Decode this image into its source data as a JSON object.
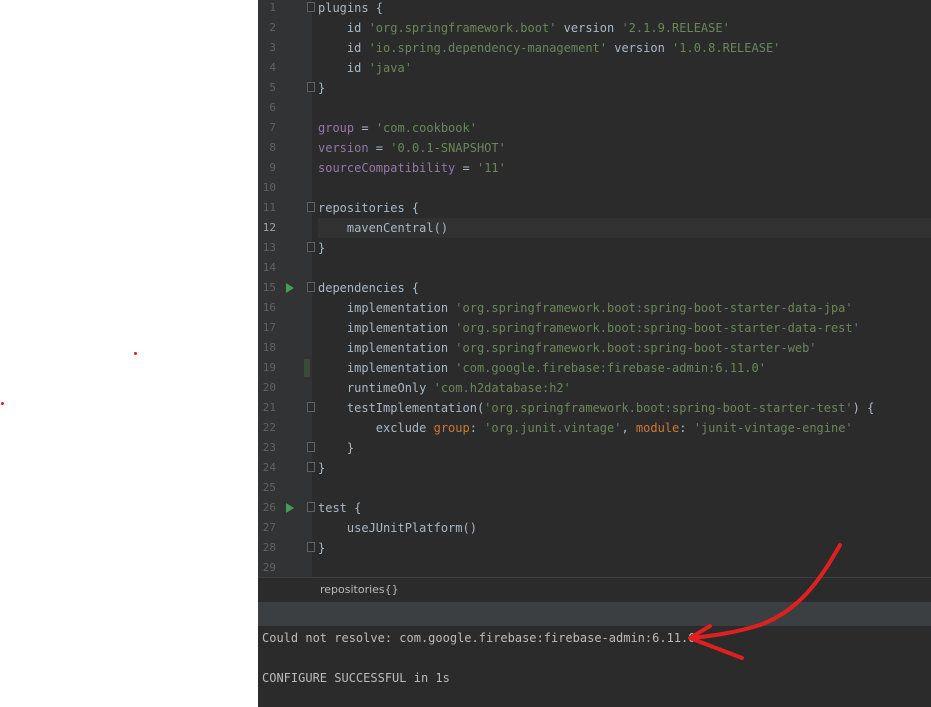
{
  "editor": {
    "current_line": 12,
    "lines": [
      {
        "num": "1",
        "fold": true,
        "run": false,
        "tokens": [
          {
            "t": "plugins {",
            "c": "plain"
          }
        ]
      },
      {
        "num": "2",
        "tokens": [
          {
            "t": "    id ",
            "c": "plain"
          },
          {
            "t": "'org.springframework.boot'",
            "c": "str"
          },
          {
            "t": " version ",
            "c": "plain"
          },
          {
            "t": "'2.1.9.RELEASE'",
            "c": "str"
          }
        ]
      },
      {
        "num": "3",
        "tokens": [
          {
            "t": "    id ",
            "c": "plain"
          },
          {
            "t": "'io.spring.dependency-management'",
            "c": "str"
          },
          {
            "t": " version ",
            "c": "plain"
          },
          {
            "t": "'1.0.8.RELEASE'",
            "c": "str"
          }
        ]
      },
      {
        "num": "4",
        "tokens": [
          {
            "t": "    id ",
            "c": "plain"
          },
          {
            "t": "'java'",
            "c": "str"
          }
        ]
      },
      {
        "num": "5",
        "fold": true,
        "tokens": [
          {
            "t": "}",
            "c": "plain"
          }
        ]
      },
      {
        "num": "6",
        "tokens": []
      },
      {
        "num": "7",
        "tokens": [
          {
            "t": "group",
            "c": "prop"
          },
          {
            "t": " = ",
            "c": "plain"
          },
          {
            "t": "'com.cookbook'",
            "c": "str"
          }
        ]
      },
      {
        "num": "8",
        "tokens": [
          {
            "t": "version",
            "c": "prop"
          },
          {
            "t": " = ",
            "c": "plain"
          },
          {
            "t": "'0.0.1-SNAPSHOT'",
            "c": "str"
          }
        ]
      },
      {
        "num": "9",
        "tokens": [
          {
            "t": "sourceCompatibility",
            "c": "prop"
          },
          {
            "t": " = ",
            "c": "plain"
          },
          {
            "t": "'11'",
            "c": "str"
          }
        ]
      },
      {
        "num": "10",
        "tokens": []
      },
      {
        "num": "11",
        "fold": true,
        "tokens": [
          {
            "t": "repositories {",
            "c": "plain"
          }
        ]
      },
      {
        "num": "12",
        "tokens": [
          {
            "t": "    mavenCentral()",
            "c": "plain"
          }
        ]
      },
      {
        "num": "13",
        "fold": true,
        "tokens": [
          {
            "t": "}",
            "c": "plain"
          }
        ]
      },
      {
        "num": "14",
        "tokens": []
      },
      {
        "num": "15",
        "fold": true,
        "run": true,
        "tokens": [
          {
            "t": "dependencies {",
            "c": "plain"
          }
        ]
      },
      {
        "num": "16",
        "tokens": [
          {
            "t": "    implementation ",
            "c": "plain"
          },
          {
            "t": "'org.springframework.boot:spring-boot-starter-data-jpa'",
            "c": "str"
          }
        ]
      },
      {
        "num": "17",
        "tokens": [
          {
            "t": "    implementation ",
            "c": "plain"
          },
          {
            "t": "'org.springframework.boot:spring-boot-starter-data-rest'",
            "c": "str"
          }
        ]
      },
      {
        "num": "18",
        "tokens": [
          {
            "t": "    implementation ",
            "c": "plain"
          },
          {
            "t": "'org.springframework.boot:spring-boot-starter-web'",
            "c": "str"
          }
        ]
      },
      {
        "num": "19",
        "changed": true,
        "tokens": [
          {
            "t": "    implementation ",
            "c": "plain"
          },
          {
            "t": "'com.google.firebase:firebase-admin:6.11.0'",
            "c": "str"
          }
        ]
      },
      {
        "num": "20",
        "tokens": [
          {
            "t": "    runtimeOnly ",
            "c": "plain"
          },
          {
            "t": "'com.h2database:h2'",
            "c": "str"
          }
        ]
      },
      {
        "num": "21",
        "fold": true,
        "tokens": [
          {
            "t": "    testImplementation(",
            "c": "plain"
          },
          {
            "t": "'org.springframework.boot:spring-boot-starter-test'",
            "c": "str"
          },
          {
            "t": ") {",
            "c": "plain"
          }
        ]
      },
      {
        "num": "22",
        "tokens": [
          {
            "t": "        exclude ",
            "c": "plain"
          },
          {
            "t": "group",
            "c": "kw"
          },
          {
            "t": ": ",
            "c": "plain"
          },
          {
            "t": "'org.junit.vintage'",
            "c": "str"
          },
          {
            "t": ", ",
            "c": "plain"
          },
          {
            "t": "module",
            "c": "kw"
          },
          {
            "t": ": ",
            "c": "plain"
          },
          {
            "t": "'junit-vintage-engine'",
            "c": "str"
          }
        ]
      },
      {
        "num": "23",
        "fold": true,
        "tokens": [
          {
            "t": "    }",
            "c": "plain"
          }
        ]
      },
      {
        "num": "24",
        "fold": true,
        "tokens": [
          {
            "t": "}",
            "c": "plain"
          }
        ]
      },
      {
        "num": "25",
        "tokens": []
      },
      {
        "num": "26",
        "fold": true,
        "run": true,
        "tokens": [
          {
            "t": "test {",
            "c": "plain"
          }
        ]
      },
      {
        "num": "27",
        "tokens": [
          {
            "t": "    useJUnitPlatform()",
            "c": "plain"
          }
        ]
      },
      {
        "num": "28",
        "fold": true,
        "tokens": [
          {
            "t": "}",
            "c": "plain"
          }
        ]
      },
      {
        "num": "29",
        "tokens": []
      }
    ]
  },
  "breadcrumb": {
    "label": "repositories{}"
  },
  "console": {
    "error_line": "Could not resolve: com.google.firebase:firebase-admin:6.11.0",
    "status_line": "CONFIGURE SUCCESSFUL in 1s"
  },
  "colors": {
    "annotation_arrow": "#e02020",
    "string": "#6a8759",
    "property": "#9876aa",
    "keyword": "#cc7832",
    "run_icon": "#499c54"
  }
}
